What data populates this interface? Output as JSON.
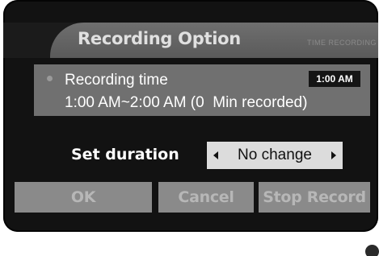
{
  "dialog": {
    "title": "Recording Option",
    "title_faint": "TIME RECORDING"
  },
  "info": {
    "bullet_icon": "bullet-icon",
    "label": "Recording time",
    "time_badge": "1:00 AM",
    "range": "1:00 AM~2:00 AM (0  Min recorded)"
  },
  "duration": {
    "label": "Set duration",
    "value": "No change",
    "left_icon": "arrow-left-icon",
    "right_icon": "arrow-right-icon"
  },
  "buttons": {
    "ok": "OK",
    "cancel": "Cancel",
    "stop": "Stop Record"
  },
  "colors": {
    "background": "#121212",
    "panel": "#707070",
    "button": "#8a8a8a",
    "select": "#dcdcdc"
  }
}
